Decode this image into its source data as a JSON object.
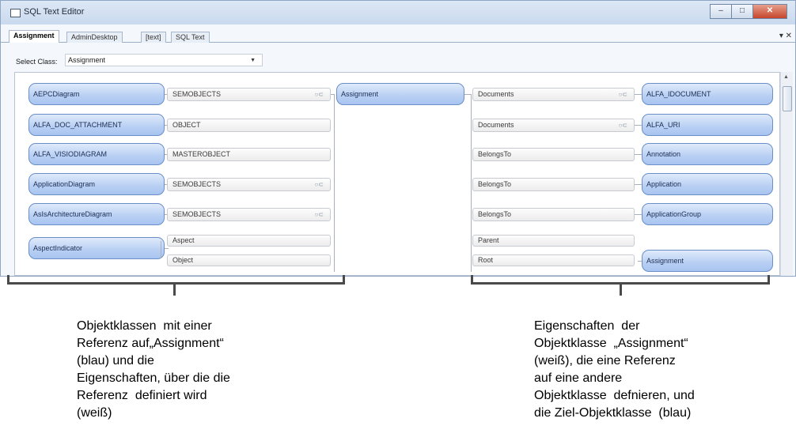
{
  "window": {
    "title": "SQL Text Editor",
    "controls": {
      "minimize": "‒",
      "maximize": "□",
      "close": "✕"
    }
  },
  "tabs": [
    "Assignment",
    "AdminDesktop",
    "[text]",
    "SQL Text"
  ],
  "tab_controls": "▾ ✕",
  "select": {
    "label": "Select Class:",
    "value": "Assignment",
    "arrow": "▼"
  },
  "diagram": {
    "center": "Assignment",
    "referencing_classes": [
      "AEPCDiagram",
      "ALFA_DOC_ATTACHMENT",
      "ALFA_VISIODIAGRAM",
      "ApplicationDiagram",
      "AsIsArchitectureDiagram",
      "AspectIndicator"
    ],
    "reference_properties": [
      "SEMOBJECTS",
      "OBJECT",
      "MASTEROBJECT",
      "SEMOBJECTS",
      "SEMOBJECTS",
      "Aspect",
      "Object"
    ],
    "own_properties": [
      "Documents",
      "Documents",
      "BelongsTo",
      "BelongsTo",
      "BelongsTo",
      "Parent",
      "Root"
    ],
    "target_classes": [
      "ALFA_IDOCUMENT",
      "ALFA_URI",
      "Annotation",
      "Application",
      "ApplicationGroup",
      "Assignment"
    ],
    "collection_marker": "○⊂"
  },
  "annotations": {
    "left": "Objektklassen  mit einer\nReferenz auf„Assignment“\n(blau) und die\nEigenschaften, über die die\nReferenz  definiert wird\n(weiß)",
    "right": "Eigenschaften  der\nObjektklasse  „Assignment“\n(weiß), die eine Referenz\nauf eine andere\nObjektklasse  defnieren, und\ndie Ziel-Objektklasse  (blau)"
  }
}
